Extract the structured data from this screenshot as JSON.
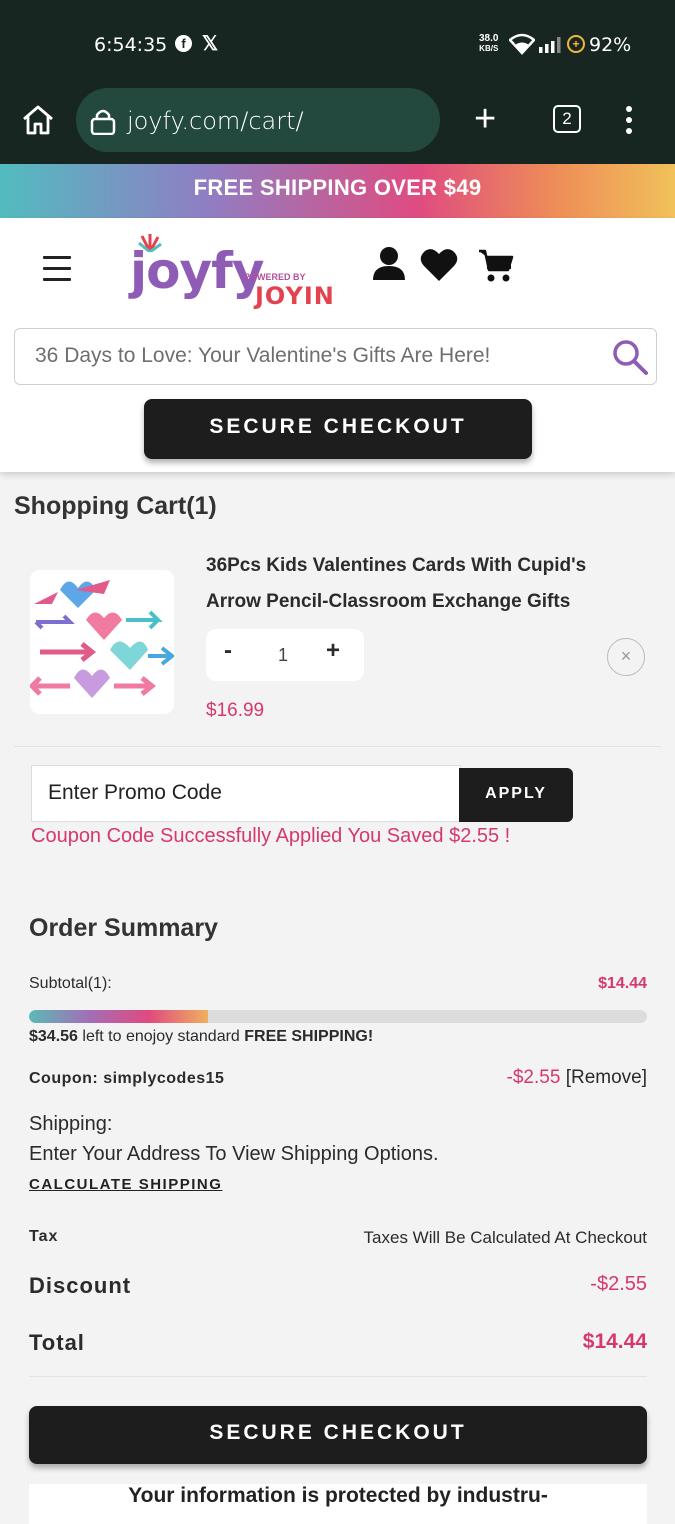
{
  "status_bar": {
    "time": "6:54:35",
    "speed_value": "38.0",
    "speed_unit": "KB/S",
    "battery": "92%"
  },
  "browser": {
    "url": "joyfy.com/cart/",
    "tab_count": "2"
  },
  "promo_banner": "FREE SHIPPING OVER $49",
  "header": {
    "logo_main": "joyfy",
    "logo_powered": "POWERED BY",
    "logo_joyin": "JOYIN",
    "search_placeholder": "36 Days to Love: Your Valentine's Gifts Are Here!",
    "checkout_label": "SECURE CHECKOUT"
  },
  "cart": {
    "title": "Shopping Cart(1)",
    "items": [
      {
        "name": "36Pcs Kids Valentines Cards With Cupid's Arrow Pencil-Classroom Exchange Gifts",
        "quantity": "1",
        "minus": "-",
        "plus": "+",
        "price": "$16.99",
        "remove": "×"
      }
    ]
  },
  "promo": {
    "placeholder": "Enter Promo Code",
    "apply_label": "APPLY",
    "success_message": "Coupon Code Successfully Applied You Saved $2.55 !"
  },
  "order_summary": {
    "title": "Order Summary",
    "subtotal_label": "Subtotal(1):",
    "subtotal_value": "$14.44",
    "free_shipping_progress": 0.29,
    "shipping_left_amount": "$34.56",
    "shipping_left_text": " left to enojoy standard ",
    "shipping_left_bold": "FREE SHIPPING!",
    "coupon_label": "Coupon: simplycodes15",
    "coupon_value": "-$2.55",
    "coupon_remove": "[Remove]",
    "shipping_label": "Shipping:",
    "shipping_text": "Enter Your Address To View Shipping Options.",
    "calculate_shipping": "CALCULATE SHIPPING",
    "tax_label": "Tax",
    "tax_value": "Taxes Will Be Calculated At Checkout",
    "discount_label": "Discount",
    "discount_value": "-$2.55",
    "total_label": "Total",
    "total_value": "$14.44",
    "checkout_label": "SECURE CHECKOUT",
    "secure_note": "Your information is protected by industru-"
  },
  "colors": {
    "accent_pink": "#d6386d",
    "dark_button": "#1d1d1d",
    "brand_purple": "#8e5cb5",
    "browser_bar": "#182622"
  }
}
